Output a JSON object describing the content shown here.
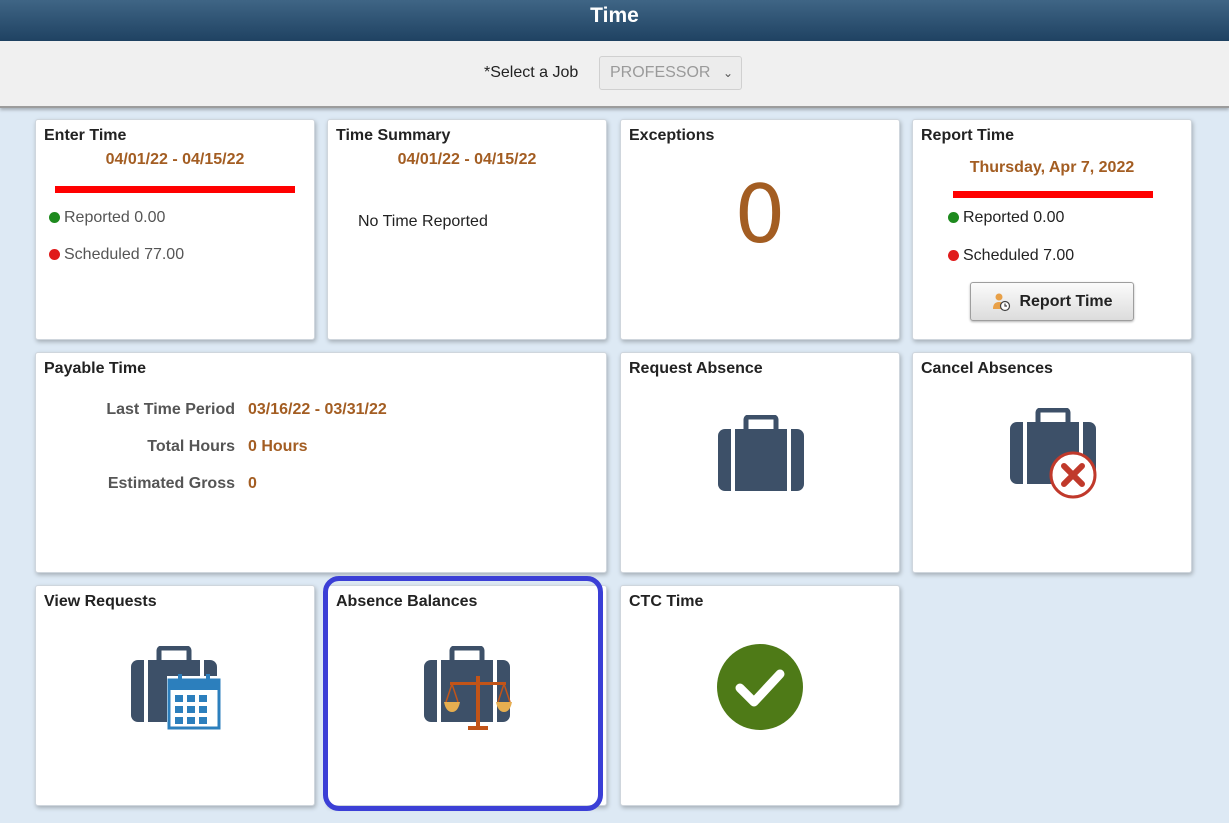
{
  "header": {
    "title": "Time"
  },
  "job_selector": {
    "label": "*Select a Job",
    "selected": "PROFESSOR"
  },
  "tiles": {
    "enter_time": {
      "title": "Enter Time",
      "period": "04/01/22 - 04/15/22",
      "reported": "Reported 0.00",
      "scheduled": "Scheduled 77.00"
    },
    "time_summary": {
      "title": "Time Summary",
      "period": "04/01/22 - 04/15/22",
      "message": "No Time Reported"
    },
    "exceptions": {
      "title": "Exceptions",
      "count": "0"
    },
    "report_time": {
      "title": "Report Time",
      "date": "Thursday, Apr 7, 2022",
      "reported": "Reported 0.00",
      "scheduled": "Scheduled 7.00",
      "button_label": "Report Time"
    },
    "payable_time": {
      "title": "Payable Time",
      "rows": [
        {
          "label": "Last Time Period",
          "value": "03/16/22 - 03/31/22"
        },
        {
          "label": "Total Hours",
          "value": "0 Hours"
        },
        {
          "label": "Estimated Gross",
          "value": "0"
        }
      ]
    },
    "request_absence": {
      "title": "Request Absence"
    },
    "cancel_absences": {
      "title": "Cancel Absences"
    },
    "view_requests": {
      "title": "View Requests"
    },
    "absence_balances": {
      "title": "Absence Balances"
    },
    "ctc_time": {
      "title": "CTC Time"
    }
  },
  "colors": {
    "accent_orange": "#a35d22",
    "header_blue": "#2a4d6e",
    "status_green": "#1e8a1e",
    "status_red": "#e01b1b",
    "icon_slate": "#3d5068",
    "check_green": "#4e7a17",
    "highlight_blue": "#3b3fd6"
  },
  "icons": {
    "request_absence": "briefcase-icon",
    "cancel_absences": "briefcase-cancel-icon",
    "view_requests": "briefcase-calendar-icon",
    "absence_balances": "briefcase-scales-icon",
    "ctc_time": "checkmark-circle-icon",
    "report_time_button": "person-clock-icon"
  }
}
